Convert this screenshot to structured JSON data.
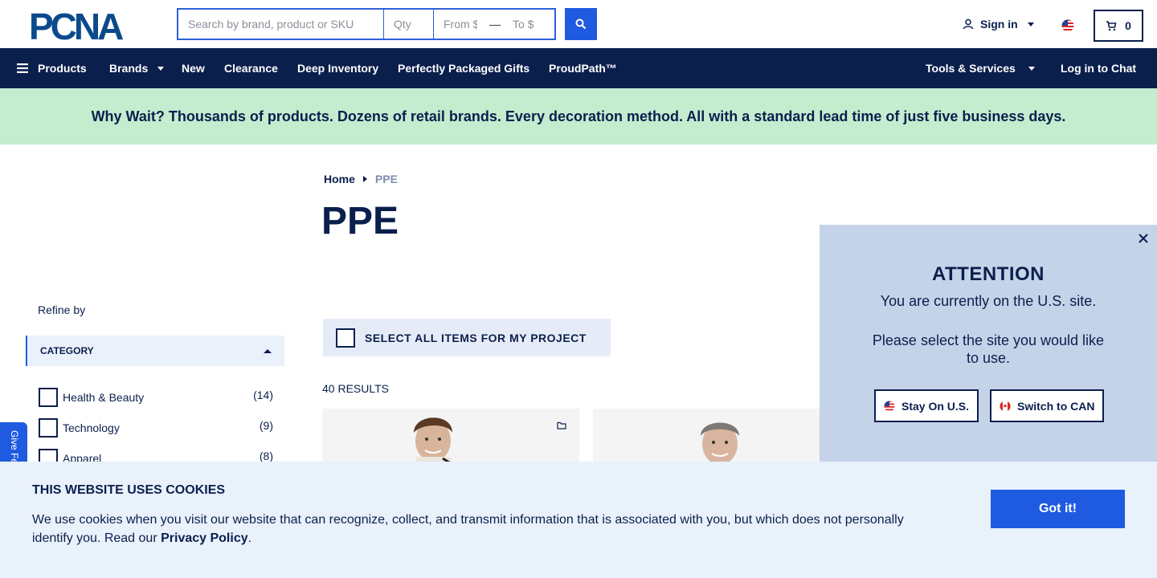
{
  "header": {
    "logo_text": "PCNA",
    "search": {
      "placeholder": "Search by brand, product or SKU",
      "qty_placeholder": "Qty",
      "from_placeholder": "From $",
      "to_placeholder": "To $",
      "dash": "—"
    },
    "signin_label": "Sign in",
    "cart_count": "0"
  },
  "nav": {
    "items": [
      {
        "label": "Products"
      },
      {
        "label": "Brands"
      },
      {
        "label": "New"
      },
      {
        "label": "Clearance"
      },
      {
        "label": "Deep Inventory"
      },
      {
        "label": "Perfectly Packaged Gifts"
      },
      {
        "label": "ProudPath™"
      }
    ],
    "tools_label": "Tools & Services",
    "chat_label": "Log in to Chat"
  },
  "promo": {
    "text": "Why Wait? Thousands of products. Dozens of retail brands. Every decoration method. All with a standard lead time of just five business days."
  },
  "breadcrumb": {
    "home": "Home",
    "current": "PPE"
  },
  "page_title": "PPE",
  "sidebar": {
    "refine_label": "Refine by",
    "category_label": "CATEGORY",
    "categories": [
      {
        "label": "Health & Beauty",
        "count": "(14)"
      },
      {
        "label": "Technology",
        "count": "(9)"
      },
      {
        "label": "Apparel",
        "count": "(8)"
      }
    ]
  },
  "feedback_label": "Give Feedback",
  "main": {
    "select_all_label": "SELECT ALL ITEMS FOR MY PROJECT",
    "results_label": "40 RESULTS"
  },
  "attention": {
    "title": "ATTENTION",
    "line1": "You are currently on the U.S. site.",
    "line2": "Please select the site you would like to use.",
    "stay_label": "Stay On U.S.",
    "switch_label": "Switch to CAN"
  },
  "cookies": {
    "title": "THIS WEBSITE USES COOKIES",
    "body": "We use cookies when you visit our website that can recognize, collect, and transmit information that is associated with you, but which does not personally identify you. Read our ",
    "link": "Privacy Policy",
    "end": ".",
    "button_label": "Got it!"
  },
  "colors": {
    "navy": "#0b1f4d",
    "accent_blue": "#1f5be0",
    "promo_green": "#c4eccf",
    "popup_bg": "#c5d3e9",
    "cookie_bg": "#e9f1fb"
  },
  "icons": [
    "menu-icon",
    "search-icon",
    "user-icon",
    "us-flag-icon",
    "cart-icon",
    "folder-icon",
    "close-icon",
    "canada-flag-icon"
  ]
}
